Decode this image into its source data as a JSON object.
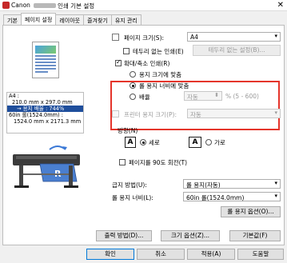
{
  "window": {
    "brand": "Canon",
    "title": "인쇄 기본 설정",
    "close_glyph": "✕"
  },
  "tabs": [
    {
      "label": "기본"
    },
    {
      "label": "페이지 설정"
    },
    {
      "label": "레이아웃"
    },
    {
      "label": "즐겨찾기"
    },
    {
      "label": "유지 관리"
    }
  ],
  "preview_info": {
    "line1": "A4 :",
    "line2": "210.0 mm x 297.0 mm",
    "line3": "→ 용지 배율 : 744%",
    "line4": "60in 롤(1524.0mm) :",
    "line5": "1524.0 mm x 2171.3 mm"
  },
  "page_size": {
    "label": "페이지 크기(S):",
    "value": "A4"
  },
  "borderless": {
    "label": "테두리 없는 인쇄(E)",
    "checked": false,
    "settings_button": "테두리 없는 설정(B)..."
  },
  "enlarge_reduce": {
    "label": "확대/축소 인쇄(R)",
    "checked": true
  },
  "scale_options": {
    "fit_paper": "용지 크기에 맞춤",
    "fit_roll": "롤 용지 너비에 맞춤",
    "scaling": "배율",
    "selected": "fit_roll"
  },
  "scaling_field": {
    "value": "자동",
    "hint": "% (5 - 600)"
  },
  "printer_paper_size": {
    "label": "프린터 용지 크기(P):",
    "value": "자동"
  },
  "orientation": {
    "label": "방향(N)",
    "portrait": "세로",
    "landscape": "가로",
    "selected": "portrait",
    "icon_glyph": "A"
  },
  "rotate_90": {
    "label": "페이지를 90도 회전(T)",
    "checked": false
  },
  "paper_source": {
    "label": "급지 방법(U):",
    "value": "롤 용지(자동)"
  },
  "roll_width": {
    "label": "롤 용지 너비(L):",
    "value": "60in 롤(1524.0mm)"
  },
  "roll_options_button": "롤 용지 옵션(O)...",
  "bottom_buttons": {
    "output_method": "출력 방법(D)...",
    "size_options": "크기 옵션(Z)...",
    "defaults": "기본값(F)"
  },
  "dialog_buttons": {
    "ok": "확인",
    "cancel": "취소",
    "apply": "적용(A)",
    "help": "도움말"
  },
  "colors": {
    "highlight": "#e5352b",
    "selection": "#1f4e9c"
  }
}
